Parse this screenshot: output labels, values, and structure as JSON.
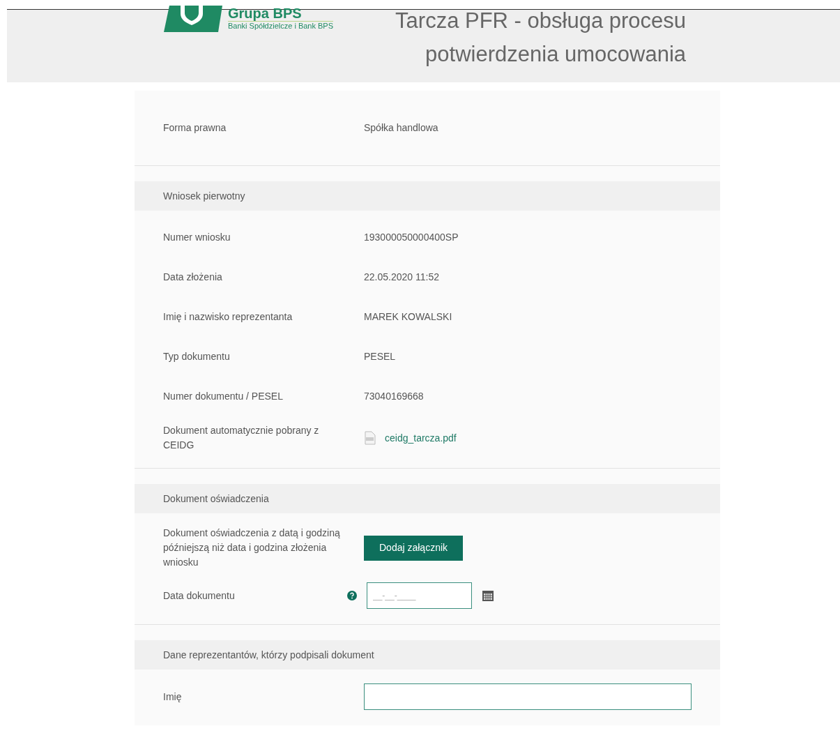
{
  "header": {
    "logo": {
      "name": "Grupa BPS",
      "tagline": "Banki Spółdzielcze i Bank BPS"
    },
    "title": "Tarcza PFR - obsługa procesu potwierdzenia umocowania"
  },
  "sections": [
    {
      "rows": [
        {
          "kind": "text",
          "label": "Forma prawna",
          "value": "Spółka handlowa"
        }
      ]
    },
    {
      "heading": "Wniosek pierwotny",
      "rows": [
        {
          "kind": "text",
          "label": "Numer wniosku",
          "value": "193000050000400SP"
        },
        {
          "kind": "text",
          "label": "Data złożenia",
          "value": "22.05.2020 11:52"
        },
        {
          "kind": "text",
          "label": "Imię i nazwisko reprezentanta",
          "value": "MAREK KOWALSKI"
        },
        {
          "kind": "text",
          "label": "Typ dokumentu",
          "value": "PESEL"
        },
        {
          "kind": "text",
          "label": "Numer dokumentu / PESEL",
          "value": "73040169668"
        },
        {
          "kind": "file",
          "label": "Dokument automatycznie pobrany z CEIDG",
          "value": "ceidg_tarcza.pdf"
        }
      ]
    },
    {
      "heading": "Dokument oświadczenia",
      "rows": [
        {
          "kind": "upload",
          "label": "Dokument oświadczenia z datą i godziną późniejszą niż data i godzina złożenia wniosku",
          "value": "Dodaj załącznik"
        },
        {
          "kind": "date",
          "label": "Data dokumentu",
          "placeholder": "__-__-____"
        }
      ]
    },
    {
      "heading": "Dane reprezentantów, którzy podpisali dokument",
      "rows": [
        {
          "kind": "input",
          "label": "Imię"
        }
      ]
    }
  ]
}
